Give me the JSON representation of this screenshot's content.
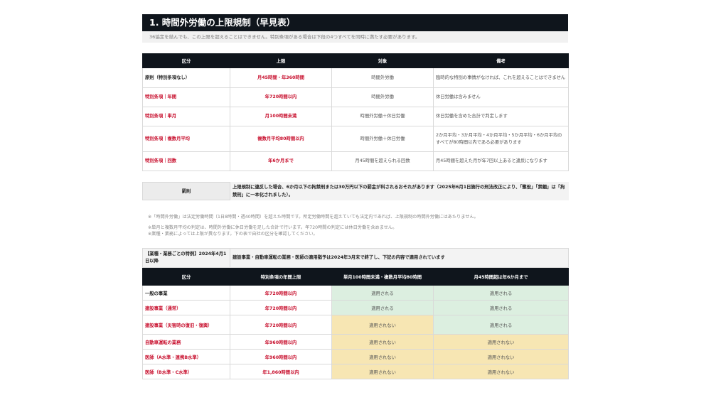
{
  "title": "1. 時間外労働の上限規制（早見表）",
  "subtitle": "36協定を結んでも、この上限を超えることはできません。特別条項がある場合は下段の4つすべてを同時に満たす必要があります。",
  "table1": {
    "headers": [
      "区分",
      "上限",
      "対象",
      "備考"
    ],
    "rows": [
      {
        "category": "原則（特別条項なし）",
        "limit": "月45時間・年360時間",
        "target": "時間外労働",
        "note": "臨時的な特別の事情がなければ、これを超えることはできません"
      },
      {
        "category": "特別条項｜年間",
        "limit": "年720時間以内",
        "target": "時間外労働",
        "note": "休日労働は含みません"
      },
      {
        "category": "特別条項｜単月",
        "limit": "月100時間未満",
        "target": "時間外労働＋休日労働",
        "note": "休日労働を含めた合計で判定します"
      },
      {
        "category": "特別条項｜複数月平均",
        "limit": "複数月平均80時間以内",
        "target": "時間外労働＋休日労働",
        "note": "2か月平均・3か月平均・4か月平均・5か月平均・6か月平均のすべてが80時間以内である必要があります"
      },
      {
        "category": "特別条項｜回数",
        "limit": "年6か月まで",
        "target": "月45時間を超えられる回数",
        "note": "月45時間を超えた月が年7回以上あると違反になります"
      }
    ]
  },
  "penalty": {
    "label": "罰則",
    "text": "上限規制に違反した場合、6か月以下の拘禁刑または30万円以下の罰金が科されるおそれがあります（2025年6月1日施行の刑法改正により、「懲役」「禁錮」は「拘禁刑」に一本化されました）。"
  },
  "notes": [
    "※「時間外労働」は法定労働時間（1日8時間・週40時間）を超えた時間です。所定労働時間を超えていても法定内であれば、上限規制の時間外労働にはあたりません。",
    "※単月と複数月平均の判定は、時間外労働に休日労働を足した合計で行います。年720時間の判定には休日労働を含めません。",
    "※業種・業務によっては上限が異なります。下の表で自社の区分を確認してください。"
  ],
  "table2": {
    "intro_label": "【業種・業務ごとの特例】2024年4月1日以降",
    "intro_text": "建設事業・自動車運転の業務・医師の適用猶予は2024年3月末で終了し、下記の内容で適用されています",
    "headers": [
      "区分",
      "特別条項の年間上限",
      "単月100時間未満・複数月平均80時間",
      "月45時間超は年6か月まで"
    ],
    "rows": [
      {
        "category": "一般の事業",
        "limit": "年720時間以内",
        "c3": "適用される",
        "c4": "適用される"
      },
      {
        "category": "建設事業（通常）",
        "limit": "年720時間以内",
        "c3": "適用される",
        "c4": "適用される"
      },
      {
        "category": "建設事業（災害時の復旧・復興）",
        "limit": "年720時間以内",
        "c3": "適用されない",
        "c4": "適用される"
      },
      {
        "category": "自動車運転の業務",
        "limit": "年960時間以内",
        "c3": "適用されない",
        "c4": "適用されない"
      },
      {
        "category": "医師（A水準・連携B水準）",
        "limit": "年960時間以内",
        "c3": "適用されない",
        "c4": "適用されない"
      },
      {
        "category": "医師（B水準・C水準）",
        "limit": "年1,860時間以内",
        "c3": "適用されない",
        "c4": "適用されない"
      }
    ]
  },
  "colors": {
    "header_dark": "#0f151c",
    "accent_red": "#c8102e",
    "applied_green": "#dcefe0",
    "not_applied_yellow": "#f7e6b3"
  }
}
